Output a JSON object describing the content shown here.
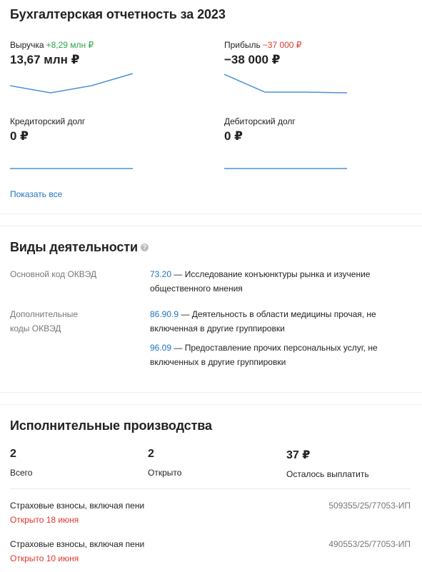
{
  "finance": {
    "title": "Бухгалтерская отчетность за 2023",
    "metrics": [
      {
        "label": "Выручка",
        "delta": "+8,29 млн ₽",
        "delta_color": "#2aa547",
        "value": "13,67 млн ₽"
      },
      {
        "label": "Прибыль",
        "delta": "−37 000 ₽",
        "delta_color": "#e0352b",
        "value": "−38 000 ₽"
      },
      {
        "label": "Кредиторский долг",
        "delta": "",
        "value": "0 ₽"
      },
      {
        "label": "Дебиторский долг",
        "delta": "",
        "value": "0 ₽"
      }
    ],
    "show_all": "Показать все",
    "line_color": "#4a90d9"
  },
  "activities": {
    "title": "Виды деятельности",
    "help_icon": "question-circle-icon",
    "main_label": "Основной код ОКВЭД",
    "main": {
      "code": "73.20",
      "text": " — Исследование конъюнктуры рынка и изучение общественного мнения"
    },
    "extra_label": "Дополнительные коды ОКВЭД",
    "extra": [
      {
        "code": "86.90.9",
        "text": " — Деятельность в области медицины прочая, не включенная в другие группировки"
      },
      {
        "code": "96.09",
        "text": " — Предоставление прочих персональных услуг, не включенных в другие группировки"
      }
    ],
    "link_color": "#1e73be"
  },
  "enforcement": {
    "title": "Исполнительные производства",
    "stats": [
      {
        "value": "2",
        "label": "Всего"
      },
      {
        "value": "2",
        "label": "Открыто"
      },
      {
        "value": "37 ₽",
        "label": "Осталось выплатить"
      }
    ],
    "cases": [
      {
        "title": "Страховые взносы, включая пени",
        "status": "Открыто 18 июня",
        "number": "509355/25/77053-ИП"
      },
      {
        "title": "Страховые взносы, включая пени",
        "status": "Открыто 10 июня",
        "number": "490553/25/77053-ИП"
      }
    ],
    "status_color": "#e0352b"
  }
}
